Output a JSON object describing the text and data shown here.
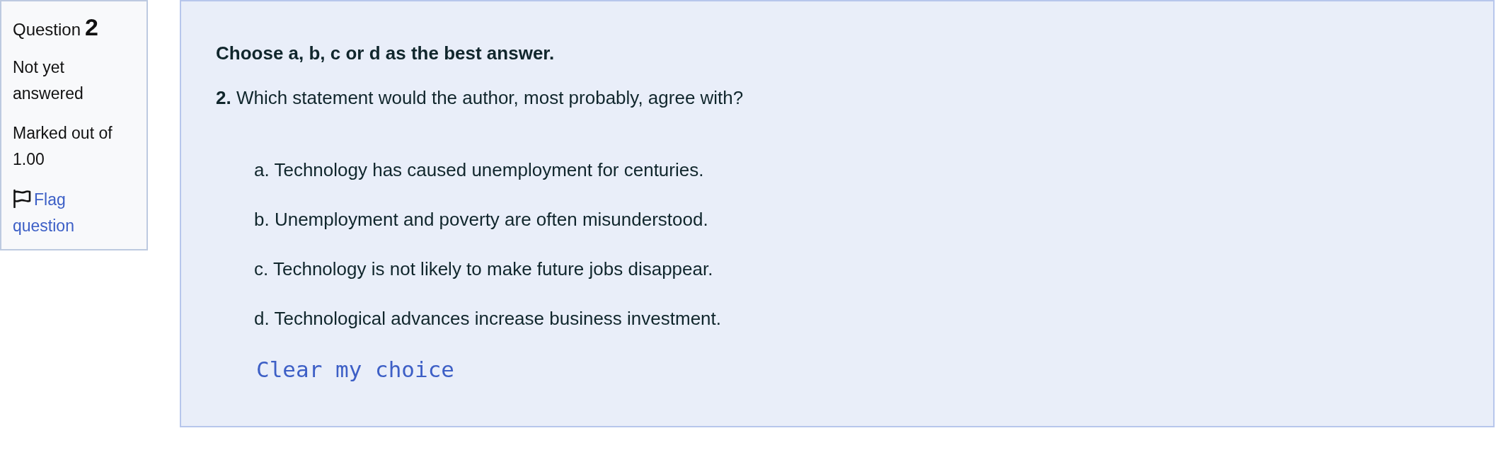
{
  "question_info": {
    "label": "Question",
    "number": "2",
    "status": "Not yet answered",
    "marks": "Marked out of 1.00",
    "flag_link": "Flag question"
  },
  "question": {
    "instruction": "Choose a, b, c or d as the best answer.",
    "prompt": "**2.** Which statement would the author, most probably, agree with?",
    "options": [
      "a. Technology has caused unemployment for centuries.",
      "b. Unemployment and poverty are often misunderstood.",
      "c. Technology is not likely to make future jobs disappear.",
      "d. Technological advances increase business investment."
    ],
    "clear_link": "Clear my choice"
  }
}
